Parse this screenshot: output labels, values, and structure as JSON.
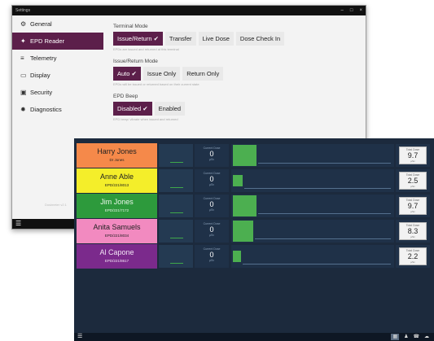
{
  "settings": {
    "title": "Settings",
    "window_controls": {
      "minimize": "–",
      "maximize": "□",
      "close": "×"
    },
    "nav": [
      {
        "label": "General",
        "icon": "gear-icon",
        "glyph": "⚙",
        "active": false
      },
      {
        "label": "EPD Reader",
        "icon": "tag-icon",
        "glyph": "✦",
        "active": true
      },
      {
        "label": "Telemetry",
        "icon": "signal-icon",
        "glyph": "≡",
        "active": false
      },
      {
        "label": "Display",
        "icon": "monitor-icon",
        "glyph": "▭",
        "active": false
      },
      {
        "label": "Security",
        "icon": "lock-icon",
        "glyph": "▣",
        "active": false
      },
      {
        "label": "Diagnostics",
        "icon": "bug-icon",
        "glyph": "✹",
        "active": false
      }
    ],
    "sidebar_footer": "Dosimeter v2.1",
    "menu_glyph": "☰",
    "terminal_mode": {
      "label": "Terminal Mode",
      "options": [
        "Issue/Return",
        "Transfer",
        "Live Dose",
        "Dose Check In"
      ],
      "selected": 0,
      "help": "EPDs are issued and returned at this terminal"
    },
    "issue_return_mode": {
      "label": "Issue/Return Mode",
      "options": [
        "Auto",
        "Issue Only",
        "Return Only"
      ],
      "selected": 0,
      "help": "EPDs will be issued or returned based on their current state"
    },
    "epd_beep": {
      "label": "EPD Beep",
      "options": [
        "Disabled",
        "Enabled"
      ],
      "selected": 0,
      "help": "EPD beep/ vibrate when issued and returned"
    }
  },
  "reader": {
    "current_label": "Current Dose",
    "current_unit": "µSv",
    "total_label": "Total Dose",
    "total_unit": "µSv",
    "rows": [
      {
        "name": "Harry Jones",
        "id": "Dr Jones",
        "color": "#f5894a",
        "current": "0",
        "fill_fraction": 0.15,
        "total": "9.7"
      },
      {
        "name": "Anne  Able",
        "id": "EPD/221/8013",
        "color": "#f4ee2a",
        "current": "0",
        "fill_fraction": 0.06,
        "total": "2.5"
      },
      {
        "name": "Jim Jones",
        "id": "EPD/221/7172",
        "color": "#2d9a3c",
        "current": "0",
        "fill_fraction": 0.15,
        "total": "9.7"
      },
      {
        "name": "Anita Samuels",
        "id": "EPD/221/8034",
        "color": "#f28ac0",
        "current": "0",
        "fill_fraction": 0.13,
        "total": "8.3"
      },
      {
        "name": "Al Capone",
        "id": "EPD/221/8617",
        "color": "#7b2a8c",
        "current": "0",
        "fill_fraction": 0.05,
        "total": "2.2"
      }
    ],
    "taskbar": {
      "menu_glyph": "☰",
      "icons": [
        {
          "name": "grid-icon",
          "glyph": "▦",
          "active": true
        },
        {
          "name": "person-icon",
          "glyph": "♟",
          "active": false
        },
        {
          "name": "phone-icon",
          "glyph": "☎",
          "active": false
        },
        {
          "name": "cloud-icon",
          "glyph": "☁",
          "active": false
        }
      ]
    }
  }
}
